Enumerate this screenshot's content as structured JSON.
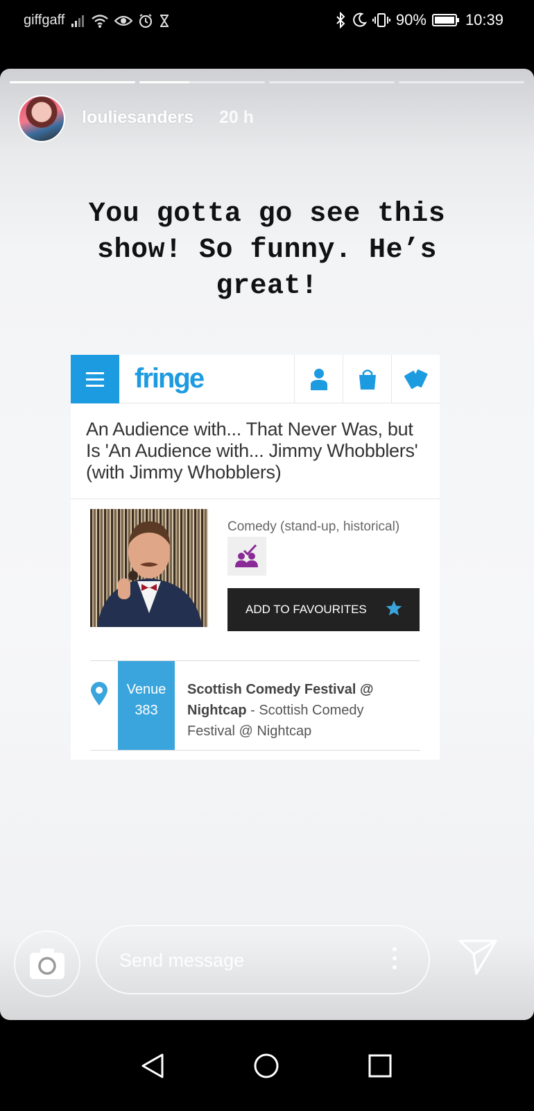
{
  "status_bar": {
    "carrier": "giffgaff",
    "battery": "90%",
    "time": "10:39",
    "left_icons": [
      "signal-icon",
      "wifi-icon",
      "eye-icon",
      "alarm-icon",
      "hourglass-icon"
    ],
    "right_icons": [
      "bluetooth-icon",
      "moon-icon",
      "vibrate-icon",
      "battery-icon"
    ]
  },
  "story": {
    "progress": [
      1.0,
      0.4,
      0.0,
      0.0
    ],
    "username": "louliesanders",
    "time_ago": "20 h",
    "caption": "You gotta go see this show! So funny. He’s great!"
  },
  "fringe": {
    "logo": "fringe",
    "header_icons": [
      "menu-icon",
      "user-icon",
      "bag-icon",
      "tickets-icon"
    ],
    "show_title": "An Audience with... That Never Was, but Is 'An Audience with... Jimmy Whobblers' (with Jimmy Whobblers)",
    "genre": "Comedy (stand-up, historical)",
    "add_to_favourites": "ADD TO FAVOURITES",
    "venue_label": "Venue",
    "venue_number": "383",
    "venue_name": "Scottish Comedy Festival @ Nightcap",
    "venue_sep": " - ",
    "venue_detail": "Scottish Comedy Festival @ Nightcap",
    "accent_color": "#1d9be0"
  },
  "composer": {
    "placeholder": "Send message"
  },
  "navigation": [
    "back-icon",
    "home-icon",
    "recents-icon"
  ]
}
